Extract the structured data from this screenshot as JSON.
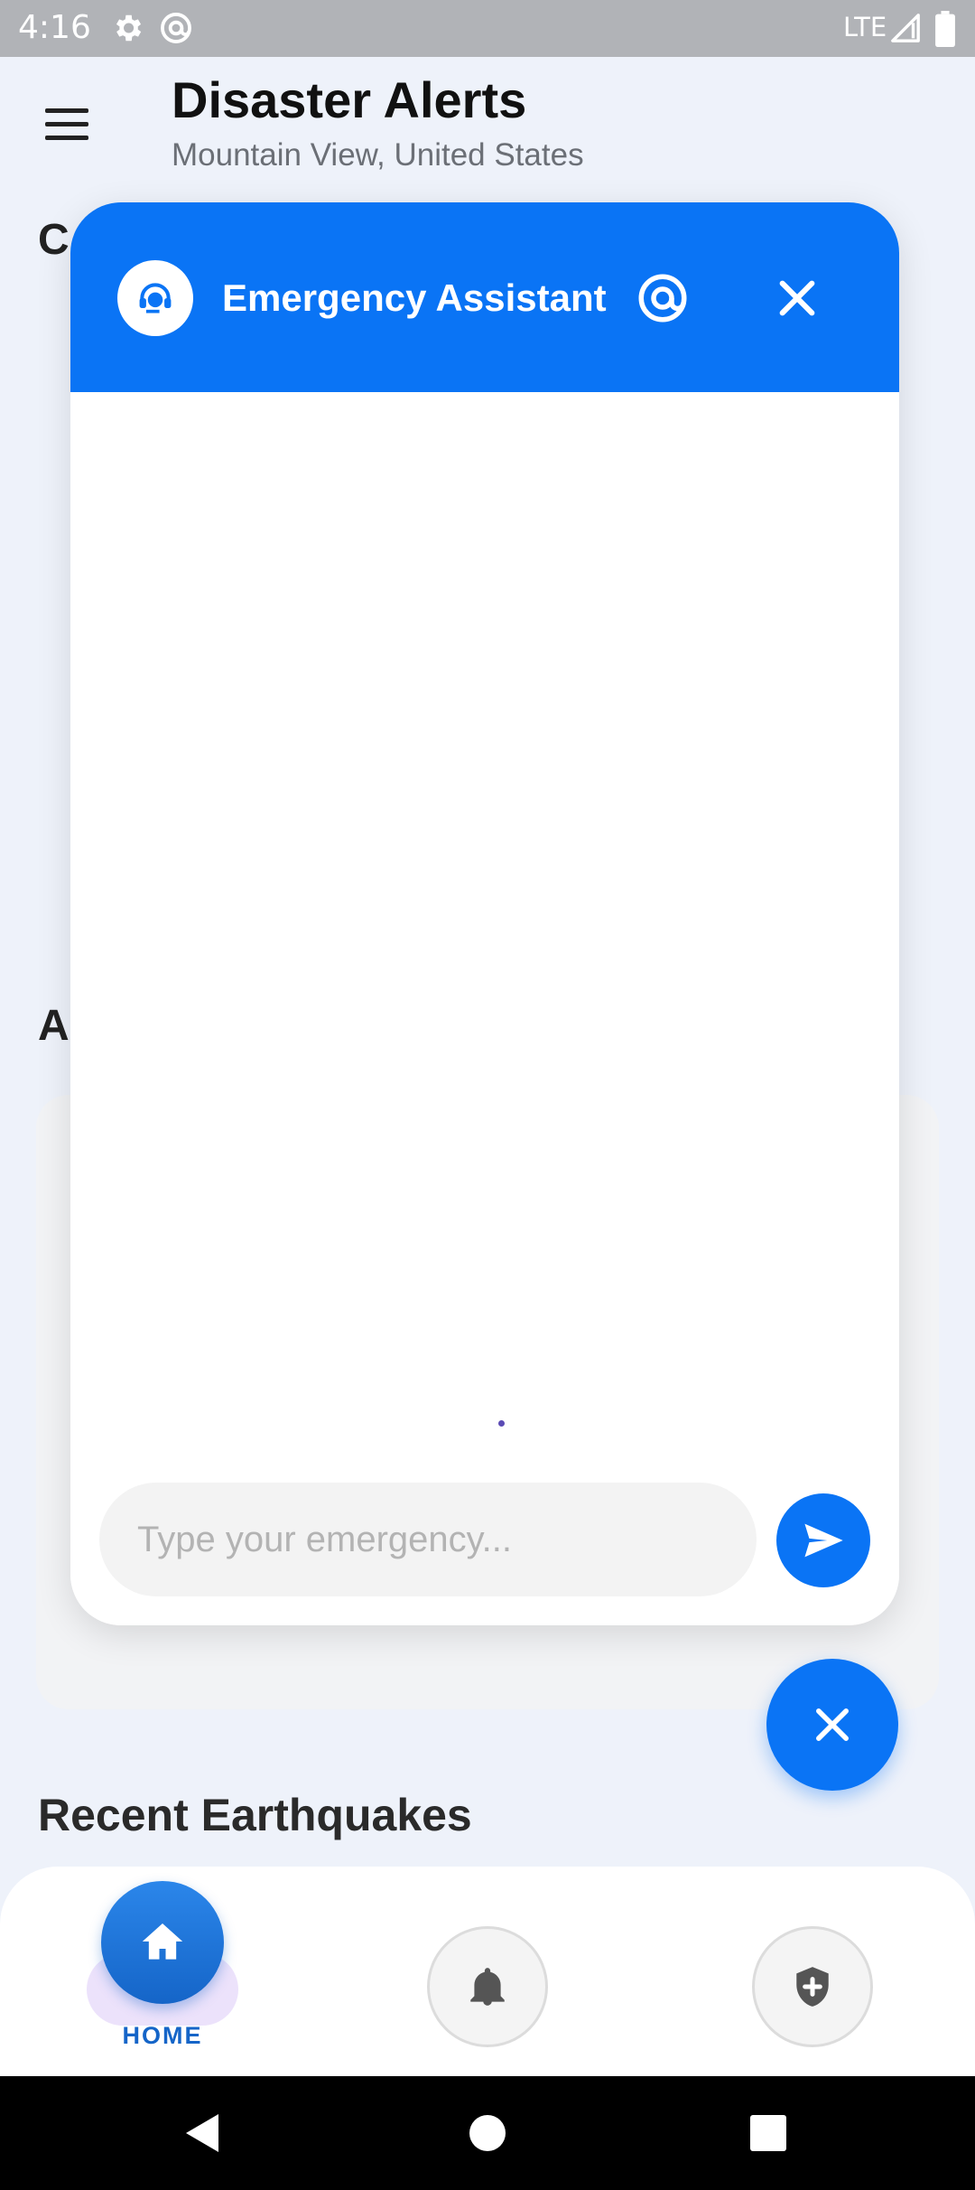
{
  "status_bar": {
    "time": "4:16",
    "network": "LTE"
  },
  "app_bar": {
    "title": "Disaster Alerts",
    "subtitle": "Mountain View, United States"
  },
  "background": {
    "heading_1": "C",
    "heading_2": "A",
    "recent_heading": "Recent Earthquakes"
  },
  "chat": {
    "title": "Emergency Assistant",
    "input_placeholder": "Type your emergency...",
    "input_value": ""
  },
  "bottom_nav": {
    "items": [
      {
        "label": "HOME",
        "icon": "home-icon",
        "active": true
      },
      {
        "label": "",
        "icon": "bell-icon",
        "active": false
      },
      {
        "label": "",
        "icon": "shield-plus-icon",
        "active": false
      }
    ]
  },
  "colors": {
    "primary": "#0a74f5",
    "nav_active": "#1565c8",
    "page_bg": "#eef2fa"
  }
}
